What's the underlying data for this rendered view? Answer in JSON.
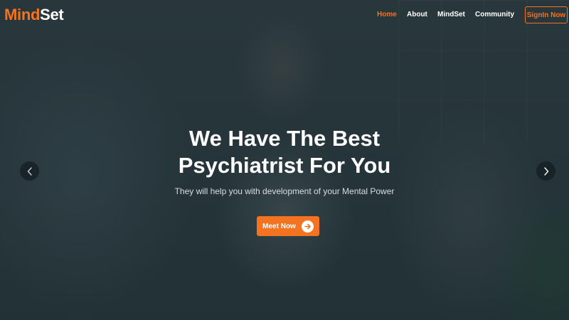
{
  "brand": {
    "part1": "Mind",
    "part2": "Set"
  },
  "nav": {
    "items": [
      {
        "label": "Home",
        "active": true
      },
      {
        "label": "About",
        "active": false
      },
      {
        "label": "MindSet",
        "active": false
      },
      {
        "label": "Community",
        "active": false
      }
    ],
    "signin_label": "SignIn Now"
  },
  "hero": {
    "headline_line1": "We Have The Best",
    "headline_line2": "Psychiatrist For You",
    "subheading": "They will help you with development of your Mental Power",
    "cta_label": "Meet Now"
  },
  "carousel": {
    "prev_icon": "chevron-left-icon",
    "next_icon": "chevron-right-icon"
  },
  "colors": {
    "accent": "#f37320",
    "text": "#ffffff",
    "overlay": "#1e2d31"
  }
}
